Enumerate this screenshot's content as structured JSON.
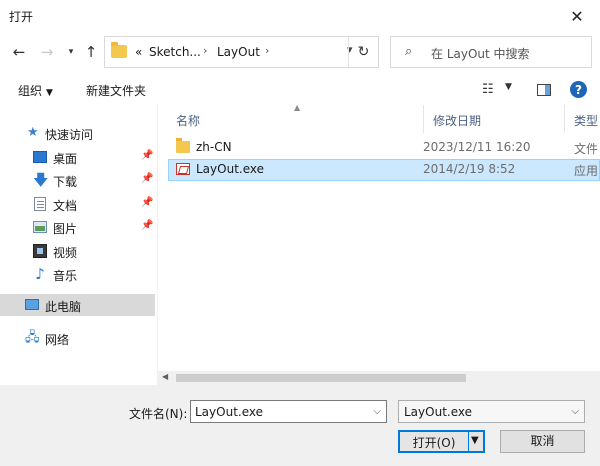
{
  "window": {
    "title": "打开"
  },
  "address": {
    "prefix": "«",
    "crumbs": [
      "Sketch...",
      "LayOut"
    ]
  },
  "search": {
    "placeholder": "在 LayOut 中搜索"
  },
  "toolbar": {
    "organize": "组织",
    "new_folder": "新建文件夹"
  },
  "sidebar": {
    "items": [
      {
        "label": "快速访问",
        "icon": "star-icon"
      },
      {
        "label": "桌面",
        "icon": "desktop-icon",
        "pinned": true
      },
      {
        "label": "下载",
        "icon": "download-icon",
        "pinned": true
      },
      {
        "label": "文档",
        "icon": "document-icon",
        "pinned": true
      },
      {
        "label": "图片",
        "icon": "pictures-icon",
        "pinned": true
      },
      {
        "label": "视频",
        "icon": "video-icon"
      },
      {
        "label": "音乐",
        "icon": "music-icon"
      },
      {
        "label": "此电脑",
        "icon": "computer-icon",
        "selected": true
      },
      {
        "label": "网络",
        "icon": "network-icon"
      }
    ]
  },
  "columns": {
    "name": "名称",
    "date": "修改日期",
    "type": "类型"
  },
  "files": [
    {
      "name": "zh-CN",
      "date": "2023/12/11 16:20",
      "type": "文件",
      "icon": "folder-icon"
    },
    {
      "name": "LayOut.exe",
      "date": "2014/2/19 8:52",
      "type": "应用",
      "icon": "exe-icon",
      "selected": true
    }
  ],
  "footer": {
    "filename_label": "文件名(N):",
    "filename_value": "LayOut.exe",
    "filetype_value": "LayOut.exe",
    "open_label": "打开(O)",
    "cancel_label": "取消"
  },
  "colors": {
    "accent": "#0078d7",
    "selection": "#cce8ff",
    "folder": "#f4c84e"
  }
}
